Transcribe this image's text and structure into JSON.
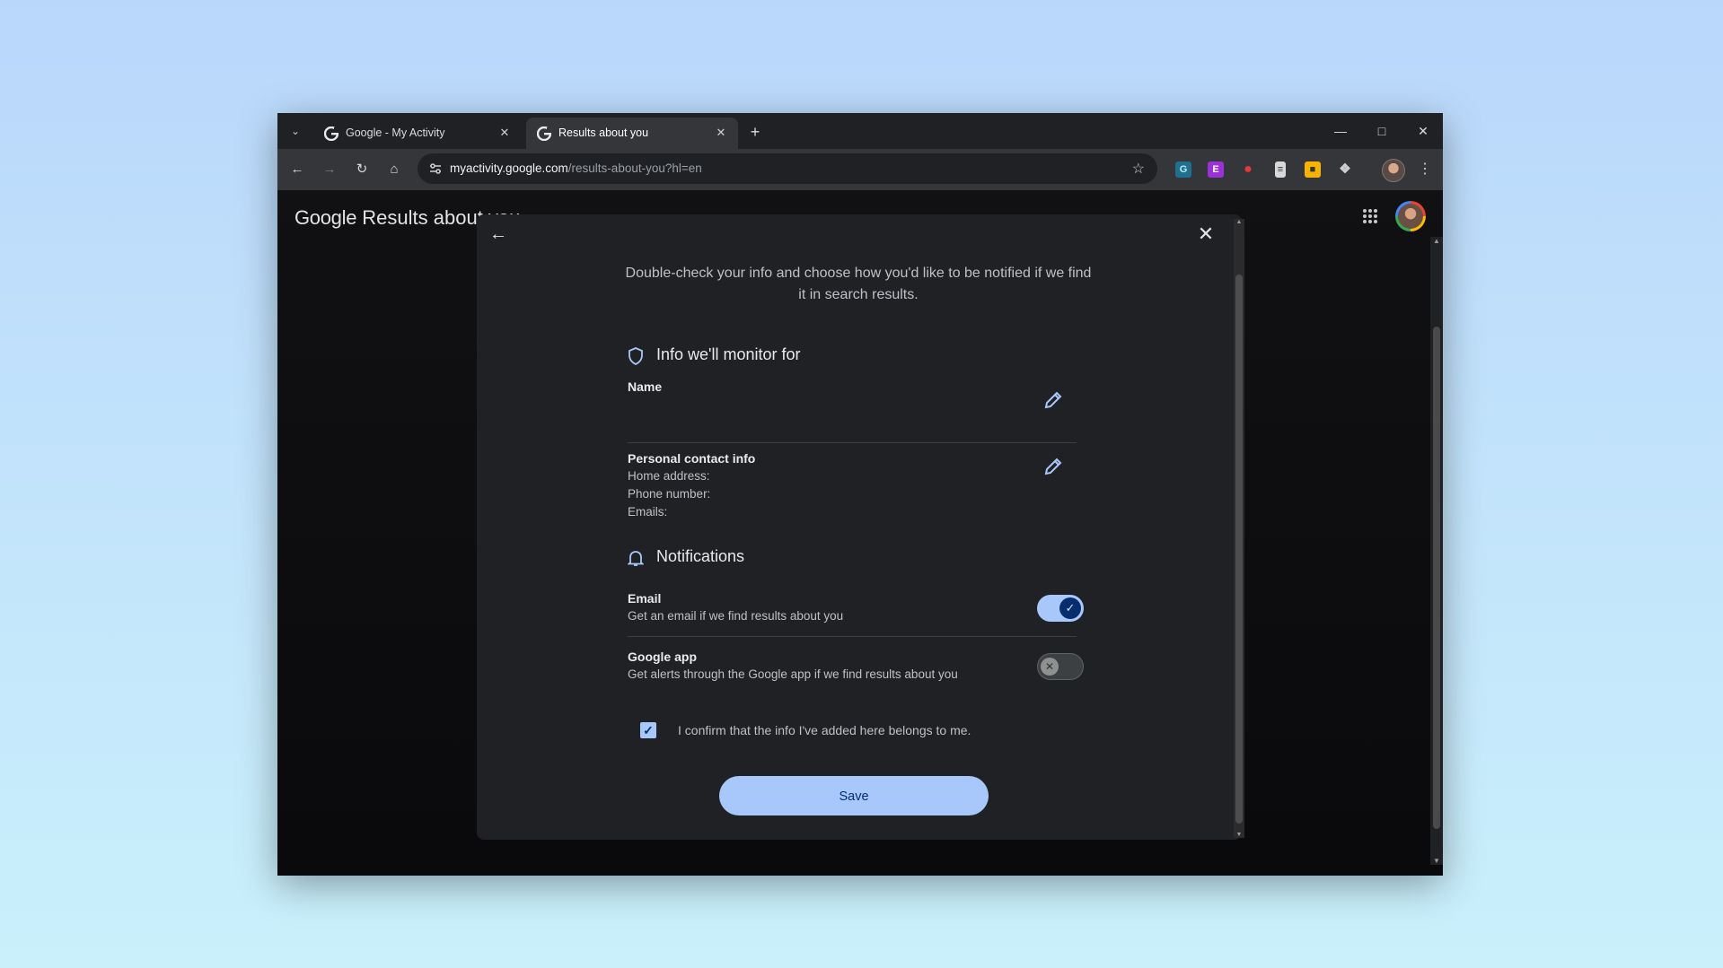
{
  "browser": {
    "tabs": [
      {
        "title": "Google - My Activity",
        "active": false
      },
      {
        "title": "Results about you",
        "active": true
      }
    ],
    "address": {
      "host": "myactivity.google.com",
      "path": "/results-about-you?hl=en"
    }
  },
  "page": {
    "brand": "Google",
    "title": "Results about you"
  },
  "dialog": {
    "intro": "Double-check your info and choose how you'd like to be notified if we find it in search results.",
    "monitor": {
      "heading": "Info we'll monitor for",
      "name_label": "Name",
      "contact_label": "Personal contact info",
      "home_address": "Home address:",
      "phone_number": "Phone number:",
      "emails": "Emails:"
    },
    "notifications": {
      "heading": "Notifications",
      "email": {
        "label": "Email",
        "description": "Get an email if we find results about you",
        "enabled": true
      },
      "google_app": {
        "label": "Google app",
        "description": "Get alerts through the Google app if we find results about you",
        "enabled": false
      }
    },
    "confirm_text": "I confirm that the info I've added here belongs to me.",
    "confirm_checked": true,
    "save_label": "Save"
  },
  "colors": {
    "accent": "#a8c7fa",
    "dialog_bg": "#202124",
    "desktop_top": "#b9d7fb",
    "desktop_bottom": "#c9f0fb"
  }
}
